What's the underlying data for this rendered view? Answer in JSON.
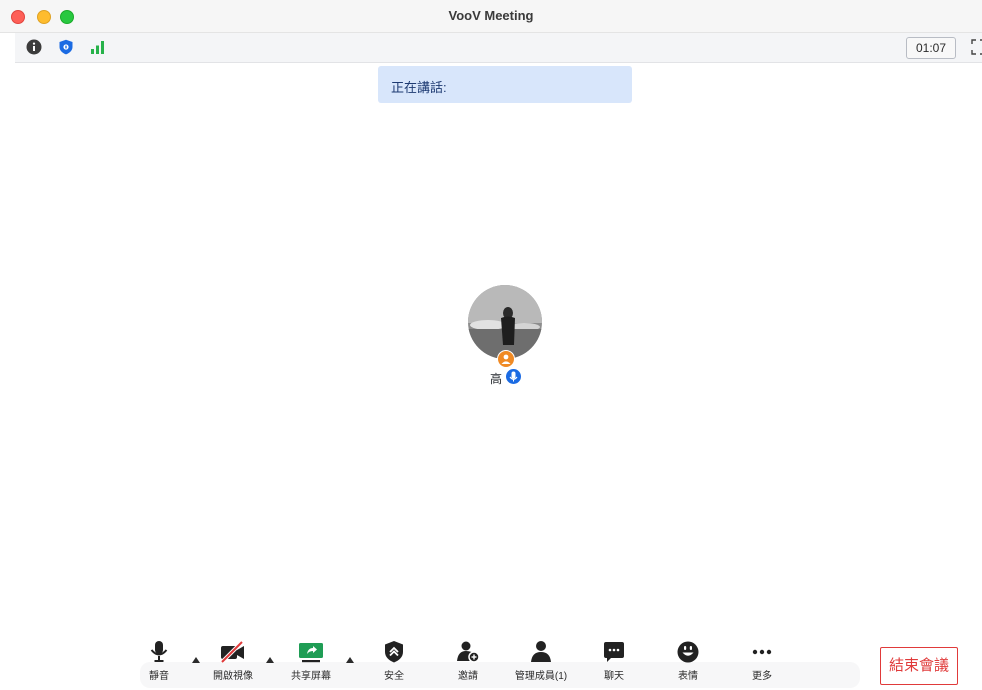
{
  "window": {
    "title": "VooV Meeting"
  },
  "infobar": {
    "timer": "01:07",
    "icons": [
      "info-icon",
      "shield-icon",
      "signal-icon",
      "fullscreen-icon"
    ]
  },
  "speaking": {
    "label": "正在講話:"
  },
  "participant": {
    "name": "高"
  },
  "toolbar": {
    "mute": "靜音",
    "video": "開啟視像",
    "share": "共享屏幕",
    "security": "安全",
    "invite": "邀請",
    "members": "管理成員(1)",
    "chat": "聊天",
    "reactions": "表情",
    "more": "更多",
    "end": "結束會議"
  },
  "colors": {
    "accent": "#1b6be3",
    "end": "#e03a3a",
    "signal": "#27b24a",
    "share": "#1f9d55",
    "host": "#f08a24"
  }
}
